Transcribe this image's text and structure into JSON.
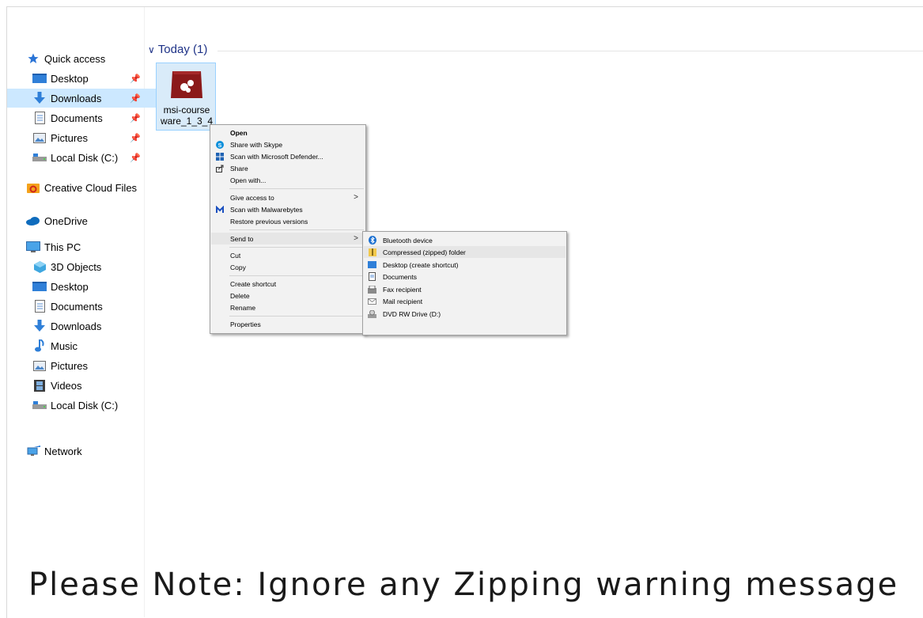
{
  "nav": {
    "quick_access": "Quick access",
    "quick_items": [
      {
        "label": "Desktop"
      },
      {
        "label": "Downloads"
      },
      {
        "label": "Documents"
      },
      {
        "label": "Pictures"
      },
      {
        "label": "Local Disk (C:)"
      }
    ],
    "creative_cloud": "Creative Cloud Files",
    "onedrive": "OneDrive",
    "this_pc": "This PC",
    "pc_items": [
      {
        "label": "3D Objects"
      },
      {
        "label": "Desktop"
      },
      {
        "label": "Documents"
      },
      {
        "label": "Downloads"
      },
      {
        "label": "Music"
      },
      {
        "label": "Pictures"
      },
      {
        "label": "Videos"
      },
      {
        "label": "Local Disk (C:)"
      }
    ],
    "network": "Network"
  },
  "content": {
    "group_header": "Today (1)",
    "file": {
      "name_line1": "msi-course",
      "name_line2": "ware_1_3_4"
    }
  },
  "context_menu": {
    "items": [
      {
        "label": "Open"
      },
      {
        "label": "Share with Skype"
      },
      {
        "label": "Scan with Microsoft Defender..."
      },
      {
        "label": "Share"
      },
      {
        "label": "Open with..."
      },
      {
        "label": "Give access to"
      },
      {
        "label": "Scan with Malwarebytes"
      },
      {
        "label": "Restore previous versions"
      },
      {
        "label": "Send to"
      },
      {
        "label": "Cut"
      },
      {
        "label": "Copy"
      },
      {
        "label": "Create shortcut"
      },
      {
        "label": "Delete"
      },
      {
        "label": "Rename"
      },
      {
        "label": "Properties"
      }
    ]
  },
  "send_to_menu": {
    "items": [
      {
        "label": "Bluetooth device"
      },
      {
        "label": "Compressed (zipped) folder"
      },
      {
        "label": "Desktop (create shortcut)"
      },
      {
        "label": "Documents"
      },
      {
        "label": "Fax recipient"
      },
      {
        "label": "Mail recipient"
      },
      {
        "label": "DVD RW Drive (D:)"
      }
    ]
  },
  "note": "Please Note: Ignore any Zipping warning message",
  "colors": {
    "selection": "#cce8ff",
    "accent": "#1e3287",
    "file_icon": "#8b1a1a"
  }
}
